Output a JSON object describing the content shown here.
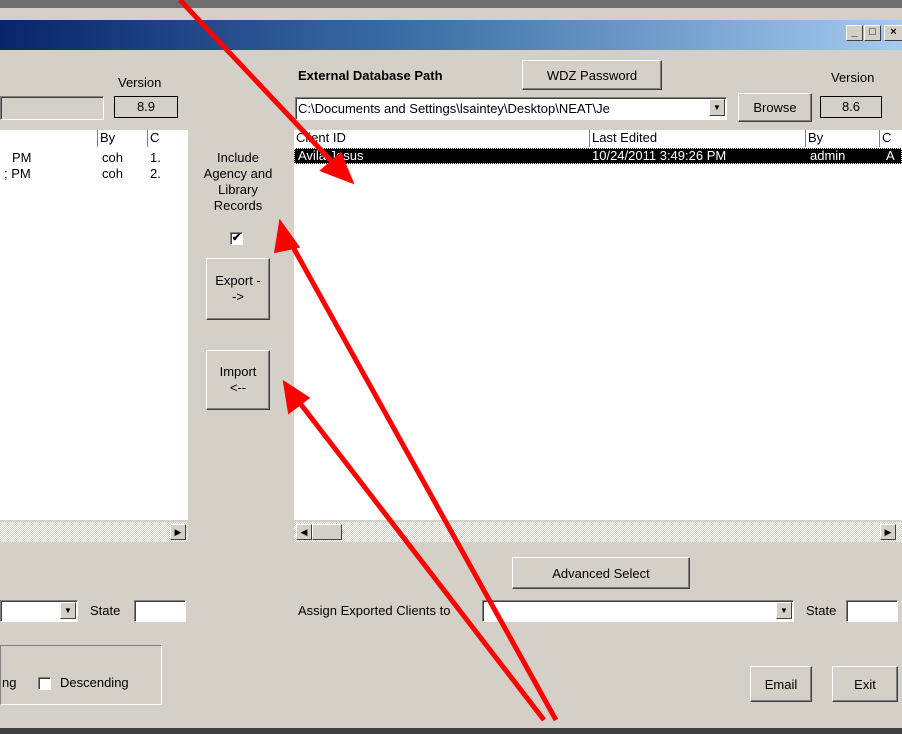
{
  "window": {
    "controls": {
      "minimize": "_",
      "restore": "□",
      "close": "×"
    }
  },
  "left": {
    "version_label": "Version",
    "version_value": "8.9",
    "columns": [
      "By",
      "C"
    ],
    "rows": [
      {
        "time": "PM",
        "by": "coh",
        "c": "1."
      },
      {
        "time": "; PM",
        "by": "coh",
        "c": "2."
      }
    ],
    "state_label": "State",
    "sort_partial": "ng",
    "descending_label": "Descending"
  },
  "middle": {
    "include_label": "Include Agency and Library Records",
    "include_checked": true,
    "export_label": "Export -->",
    "import_label": "Import <--"
  },
  "right": {
    "external_db_label": "External Database Path",
    "wdz_password_label": "WDZ Password",
    "version_label": "Version",
    "version_value": "8.6",
    "path_value": "C:\\Documents and Settings\\lsaintey\\Desktop\\NEAT\\Je",
    "browse_label": "Browse",
    "columns": [
      "Client ID",
      "Last Edited",
      "By",
      "C"
    ],
    "rows": [
      {
        "client": "Avila Jesus",
        "edited": "10/24/2011 3:49:26 PM",
        "by": "admin",
        "c": "A"
      }
    ],
    "advanced_select_label": "Advanced Select",
    "assign_label": "Assign Exported Clients to",
    "state_label": "State",
    "email_label": "Email",
    "exit_label": "Exit"
  },
  "colors": {
    "window_bg": "#d4d0c8",
    "title_gradient_start": "#0a246a",
    "title_gradient_end": "#a6caf0",
    "selection": "#000000",
    "annotation_arrow": "#ff0000"
  },
  "icons": {
    "scroll_left": "◀",
    "scroll_right": "▶",
    "dropdown": "▼",
    "check": "✔"
  }
}
